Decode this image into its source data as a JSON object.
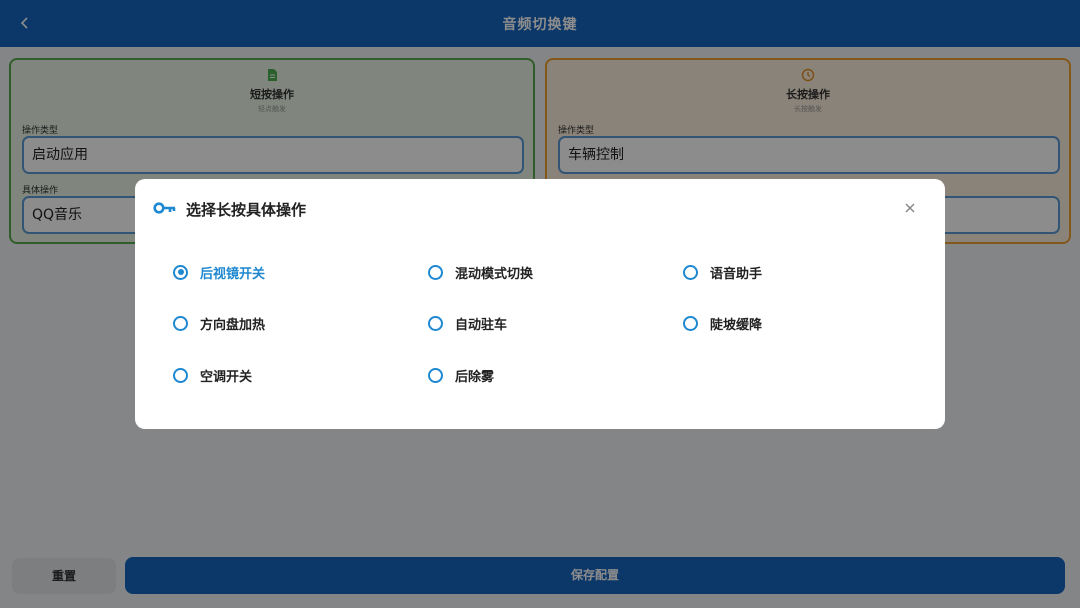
{
  "header": {
    "title": "音频切换键",
    "back_icon": "chevron-left-icon"
  },
  "short_card": {
    "icon": "document-icon",
    "title": "短按操作",
    "subtitle": "轻点触发",
    "type_label": "操作类型",
    "type_value": "启动应用",
    "action_label": "具体操作",
    "action_value": "QQ音乐",
    "border_color": "#5aa84f"
  },
  "long_card": {
    "icon": "clock-icon",
    "title": "长按操作",
    "subtitle": "长按触发",
    "type_label": "操作类型",
    "type_value": "车辆控制",
    "border_color": "#f0a030"
  },
  "footer": {
    "reset_label": "重置",
    "save_label": "保存配置"
  },
  "dialog": {
    "icon": "key-icon",
    "title": "选择长按具体操作",
    "close_icon": "close-icon",
    "options": [
      {
        "label": "后视镜开关",
        "selected": true
      },
      {
        "label": "混动模式切换",
        "selected": false
      },
      {
        "label": "语音助手",
        "selected": false
      },
      {
        "label": "方向盘加热",
        "selected": false
      },
      {
        "label": "自动驻车",
        "selected": false
      },
      {
        "label": "陡坡缓降",
        "selected": false
      },
      {
        "label": "空调开关",
        "selected": false
      },
      {
        "label": "后除雾",
        "selected": false
      }
    ]
  },
  "colors": {
    "primary": "#1565c0",
    "accent": "#1e88d0"
  }
}
